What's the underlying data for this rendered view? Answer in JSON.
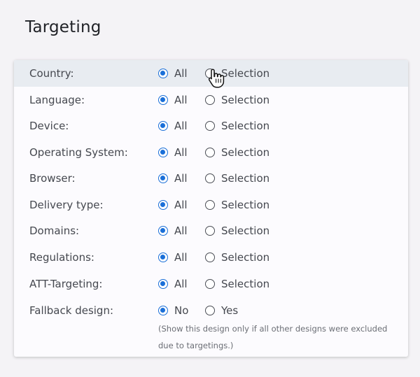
{
  "page": {
    "title": "Targeting"
  },
  "targeting": {
    "rows": [
      {
        "label": "Country:",
        "option1": "All",
        "option2": "Selection",
        "selected": 1
      },
      {
        "label": "Language:",
        "option1": "All",
        "option2": "Selection",
        "selected": 1
      },
      {
        "label": "Device:",
        "option1": "All",
        "option2": "Selection",
        "selected": 1
      },
      {
        "label": "Operating System:",
        "option1": "All",
        "option2": "Selection",
        "selected": 1
      },
      {
        "label": "Browser:",
        "option1": "All",
        "option2": "Selection",
        "selected": 1
      },
      {
        "label": "Delivery type:",
        "option1": "All",
        "option2": "Selection",
        "selected": 1
      },
      {
        "label": "Domains:",
        "option1": "All",
        "option2": "Selection",
        "selected": 1
      },
      {
        "label": "Regulations:",
        "option1": "All",
        "option2": "Selection",
        "selected": 1
      },
      {
        "label": "ATT-Targeting:",
        "option1": "All",
        "option2": "Selection",
        "selected": 1
      },
      {
        "label": "Fallback design:",
        "option1": "No",
        "option2": "Yes",
        "selected": 1
      }
    ],
    "fallback_note": "(Show this design only if all other designs were excluded due to targetings.)"
  },
  "colors": {
    "accent": "#1a6fd8",
    "hover_row": "#e8ecf1",
    "background": "#f4f3f6",
    "card": "#fcfbfe"
  },
  "cursor": {
    "icon": "hand-pointer-icon"
  }
}
